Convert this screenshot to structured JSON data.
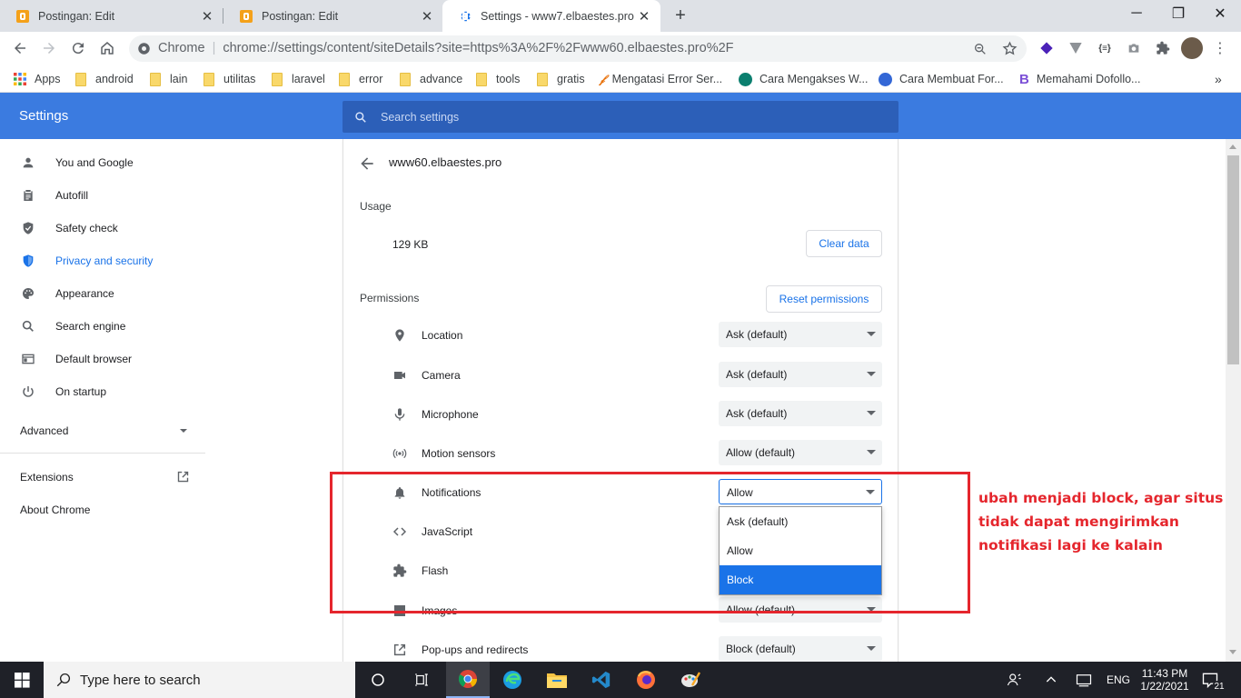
{
  "browser": {
    "tabs": [
      {
        "title": "Postingan: Edit"
      },
      {
        "title": "Postingan: Edit"
      },
      {
        "title": "Settings - www7.elbaestes.pro"
      }
    ],
    "omnibox": {
      "site": "Chrome",
      "url": "chrome://settings/content/siteDetails?site=https%3A%2F%2Fwww60.elbaestes.pro%2F"
    },
    "bookmarks": [
      {
        "label": "Apps",
        "kind": "apps"
      },
      {
        "label": "android",
        "kind": "folder"
      },
      {
        "label": "lain",
        "kind": "folder"
      },
      {
        "label": "utilitas",
        "kind": "folder"
      },
      {
        "label": "laravel",
        "kind": "folder"
      },
      {
        "label": "error",
        "kind": "folder"
      },
      {
        "label": "advance",
        "kind": "folder"
      },
      {
        "label": "tools",
        "kind": "folder"
      },
      {
        "label": "gratis",
        "kind": "folder"
      },
      {
        "label": "Mengatasi Error Ser...",
        "kind": "site"
      },
      {
        "label": "Cara Mengakses W...",
        "kind": "site"
      },
      {
        "label": "Cara Membuat For...",
        "kind": "site"
      },
      {
        "label": "Memahami Dofollo...",
        "kind": "site"
      }
    ]
  },
  "settings": {
    "title": "Settings",
    "search_placeholder": "Search settings",
    "sidebar": [
      {
        "label": "You and Google",
        "icon": "person-icon"
      },
      {
        "label": "Autofill",
        "icon": "clipboard-icon"
      },
      {
        "label": "Safety check",
        "icon": "shield-check-icon"
      },
      {
        "label": "Privacy and security",
        "icon": "shield-icon",
        "active": true
      },
      {
        "label": "Appearance",
        "icon": "palette-icon"
      },
      {
        "label": "Search engine",
        "icon": "search-icon"
      },
      {
        "label": "Default browser",
        "icon": "browser-icon"
      },
      {
        "label": "On startup",
        "icon": "power-icon"
      }
    ],
    "advanced": "Advanced",
    "extensions": "Extensions",
    "about": "About Chrome"
  },
  "site_details": {
    "site": "www60.elbaestes.pro",
    "usage_label": "Usage",
    "usage_value": "129 KB",
    "clear_data": "Clear data",
    "permissions_label": "Permissions",
    "reset_permissions": "Reset permissions",
    "permissions": [
      {
        "label": "Location",
        "value": "Ask (default)",
        "icon": "location-icon"
      },
      {
        "label": "Camera",
        "value": "Ask (default)",
        "icon": "camera-icon"
      },
      {
        "label": "Microphone",
        "value": "Ask (default)",
        "icon": "microphone-icon"
      },
      {
        "label": "Motion sensors",
        "value": "Allow (default)",
        "icon": "sensors-icon"
      },
      {
        "label": "Notifications",
        "value": "Allow",
        "icon": "bell-icon"
      },
      {
        "label": "JavaScript",
        "value": "",
        "icon": "code-icon"
      },
      {
        "label": "Flash",
        "value": "",
        "icon": "puzzle-icon"
      },
      {
        "label": "Images",
        "value": "Allow (default)",
        "icon": "image-icon"
      },
      {
        "label": "Pop-ups and redirects",
        "value": "Block (default)",
        "icon": "open-in-new-icon"
      }
    ],
    "dropdown_options": [
      "Ask (default)",
      "Allow",
      "Block"
    ],
    "dropdown_highlighted": "Block"
  },
  "annotation": {
    "text": "ubah menjadi block, agar situs tidak dapat mengirimkan notifikasi lagi ke kalain",
    "color": "#e5262d"
  },
  "taskbar": {
    "search_placeholder": "Type here to search",
    "language": "ENG",
    "time": "11:43 PM",
    "date": "1/22/2021",
    "notification_count": "21"
  },
  "colors": {
    "accent": "#1a73e8",
    "header": "#3b7be0"
  }
}
